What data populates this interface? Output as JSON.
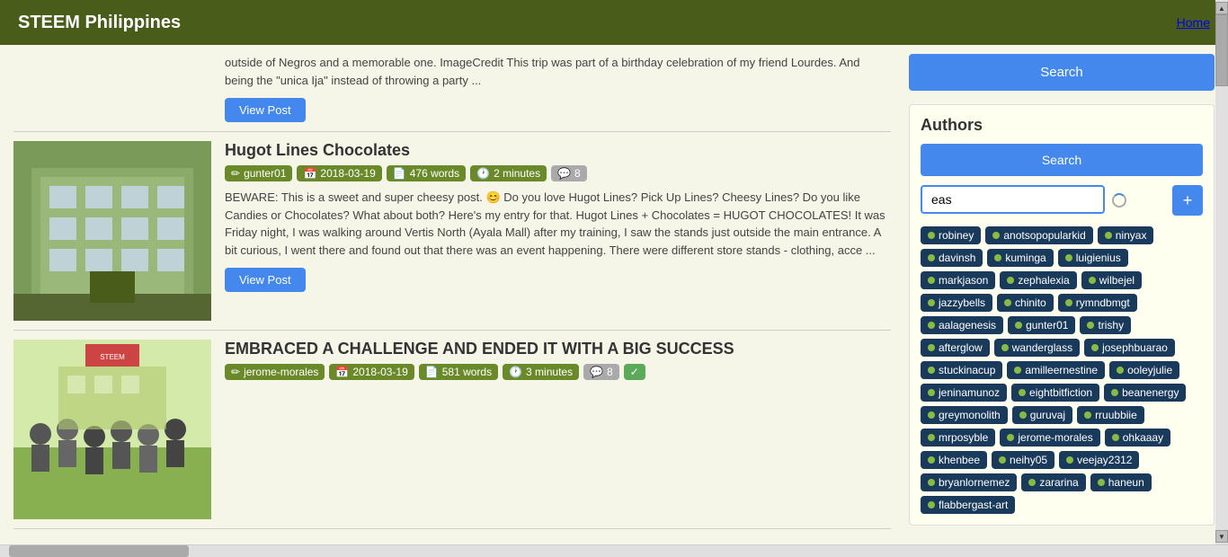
{
  "header": {
    "title": "STEEM Philippines",
    "nav": {
      "home": "Home"
    }
  },
  "partial_post": {
    "text": "outside of Negros and a memorable one. ImageCredit This trip was part of a birthday celebration of my friend Lourdes. And being the \"unica Ija\" instead of throwing a party ...",
    "view_btn": "View Post"
  },
  "posts": [
    {
      "title": "Hugot Lines Chocolates",
      "author": "gunter01",
      "date": "2018-03-19",
      "words": "476 words",
      "read_time": "2 minutes",
      "comments": "8",
      "verified": false,
      "excerpt": "BEWARE: This is a sweet and super cheesy post. 😊 Do you love Hugot Lines? Pick Up Lines? Cheesy Lines? Do you like Candies or Chocolates? What about both? Here's my entry for that. Hugot Lines + Chocolates = HUGOT CHOCOLATES! It was Friday night, I was walking around Vertis North (Ayala Mall) after my training, I saw the stands just outside the main entrance. A bit curious, I went there and found out that there was an event happening. There were different store stands - clothing, acce ...",
      "view_btn": "View Post",
      "thumbnail_type": "building"
    },
    {
      "title": "EMBRACED A CHALLENGE AND ENDED IT WITH A BIG SUCCESS",
      "author": "jerome-morales",
      "date": "2018-03-19",
      "words": "581 words",
      "read_time": "3 minutes",
      "comments": "8",
      "verified": true,
      "excerpt": "",
      "view_btn": "View Post",
      "thumbnail_type": "group"
    }
  ],
  "sidebar": {
    "top_search_btn": "Search",
    "authors_section": {
      "title": "Authors",
      "search_btn": "Search",
      "input_value": "eas",
      "input_placeholder": "",
      "add_btn": "+",
      "tags": [
        "robiney",
        "anotsopopularkid",
        "ninyax",
        "davinsh",
        "kuminga",
        "luigienius",
        "markjason",
        "zephalexia",
        "wilbejel",
        "jazzybells",
        "chinito",
        "rymndbmgt",
        "aalagenesis",
        "gunter01",
        "trishy",
        "afterglow",
        "wanderglass",
        "josephbuarao",
        "stuckinacup",
        "amilleernestine",
        "ooleyjulie",
        "jeninamunoz",
        "eightbitfiction",
        "beanenergy",
        "greymonolith",
        "guruvaj",
        "rruubbiie",
        "mrposyble",
        "jerome-morales",
        "ohkaaay",
        "khenbee",
        "neihy05",
        "veejay2312",
        "bryanlornemez",
        "zararina",
        "haneun",
        "flabbergast-art"
      ]
    }
  }
}
